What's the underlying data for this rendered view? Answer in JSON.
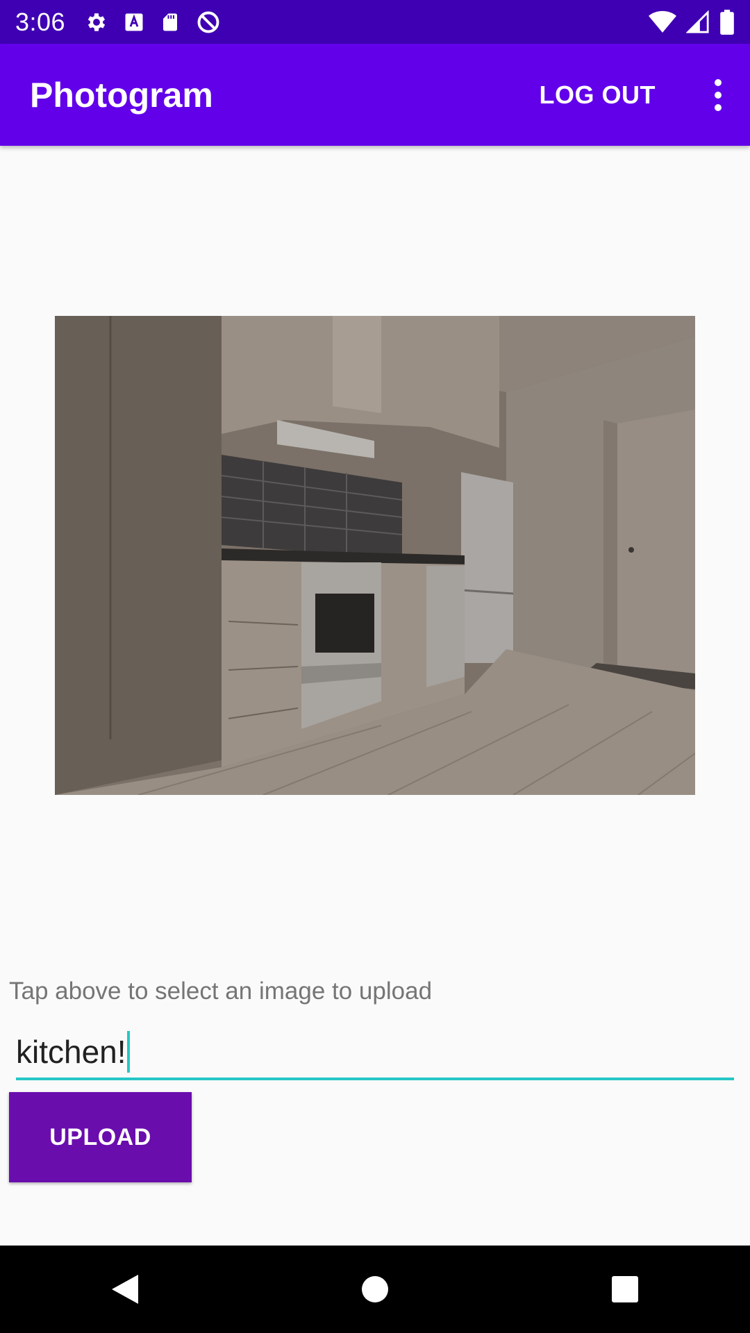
{
  "status_bar": {
    "time": "3:06",
    "left_icons": [
      "gear-icon",
      "text-a-icon",
      "sd-card-icon",
      "do-not-disturb-icon"
    ],
    "right_icons": [
      "wifi-icon",
      "cell-signal-icon",
      "battery-icon"
    ]
  },
  "app_bar": {
    "title": "Photogram",
    "logout_label": "LOG OUT",
    "menu_icon": "more-vert-icon",
    "color": "#6200ea"
  },
  "main": {
    "image_alt": "kitchen photo",
    "hint": "Tap above to select an image to upload",
    "caption_value": "kitchen!",
    "upload_label": "UPLOAD",
    "accent": "#26c6c6",
    "button_color": "#6a0dad"
  },
  "nav_bar": {
    "icons": [
      "back-triangle-icon",
      "home-circle-icon",
      "recents-square-icon"
    ]
  }
}
